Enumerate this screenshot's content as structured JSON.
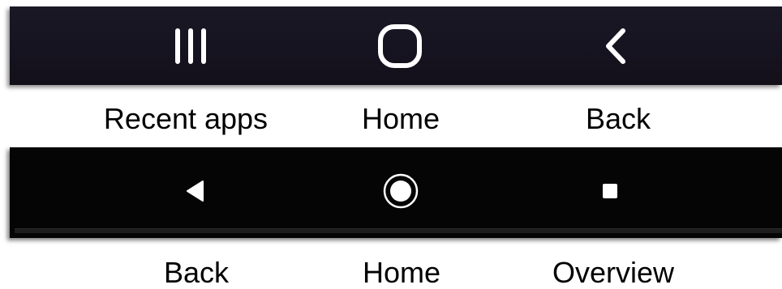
{
  "top_bar": {
    "buttons": [
      {
        "icon": "recent-apps-icon"
      },
      {
        "icon": "home-icon"
      },
      {
        "icon": "back-chevron-icon"
      }
    ],
    "labels": {
      "recent": "Recent apps",
      "home": "Home",
      "back": "Back"
    },
    "colors": {
      "background": "#161320",
      "icon": "#ffffff"
    }
  },
  "bottom_bar": {
    "buttons": [
      {
        "icon": "back-triangle-icon"
      },
      {
        "icon": "home-circle-icon"
      },
      {
        "icon": "overview-square-icon"
      }
    ],
    "labels": {
      "back": "Back",
      "home": "Home",
      "overview": "Overview"
    },
    "colors": {
      "background": "#050505",
      "icon": "#ffffff"
    }
  }
}
